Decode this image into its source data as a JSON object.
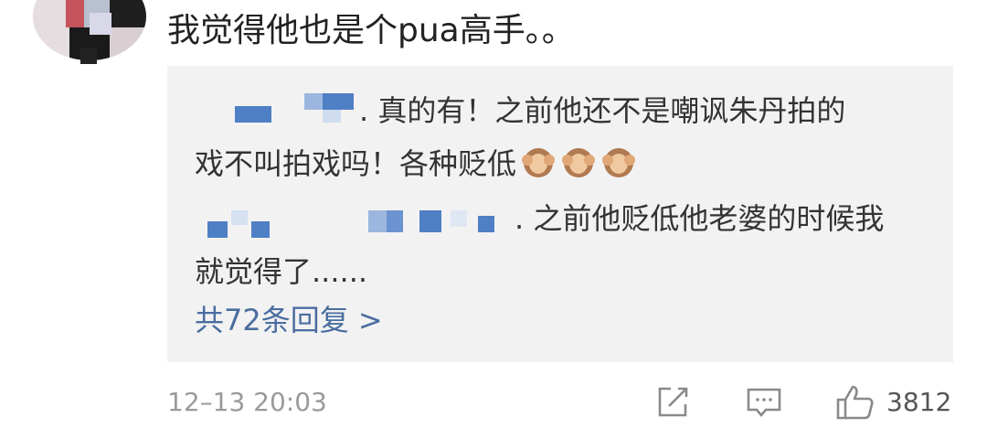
{
  "comment": {
    "text": "我觉得他也是个pua高手。。"
  },
  "replies": [
    {
      "suffix": ". 真的有！之前他还不是嘲讽朱丹拍的",
      "line2": "戏不叫拍戏吗！各种贬低",
      "emoji": [
        "see-no-evil-monkey",
        "see-no-evil-monkey",
        "see-no-evil-monkey"
      ]
    },
    {
      "suffix": ". 之前他贬低他老婆的时候我",
      "line2": "就觉得了......"
    }
  ],
  "more_replies_label": "共72条回复 >",
  "footer": {
    "timestamp": "12–13 20:03",
    "like_count": "3812",
    "icons": [
      "share-icon",
      "comment-icon",
      "like-icon"
    ]
  },
  "colors": {
    "link": "#4a6da0",
    "reply_background": "#f2f2f2",
    "muted": "#9a9a9a",
    "pixelated_blue": "#4f7fc4"
  }
}
